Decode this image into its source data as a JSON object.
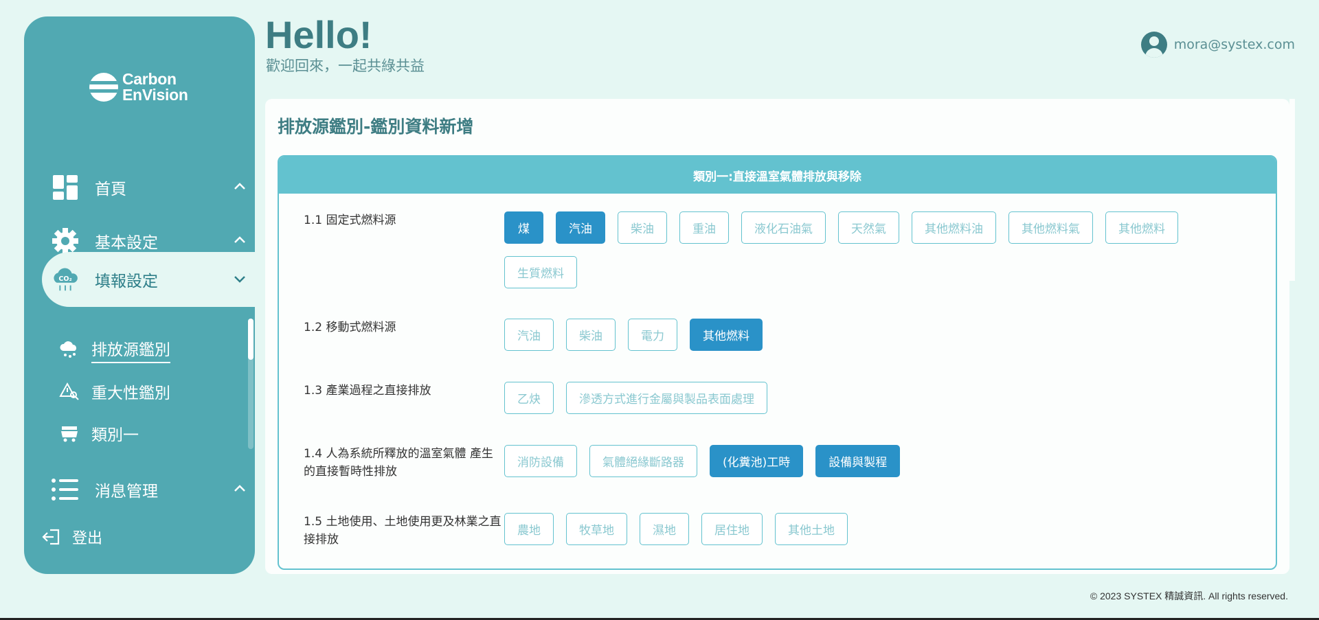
{
  "brand": {
    "line1": "Carbon",
    "line2": "EnVision"
  },
  "header": {
    "hello": "Hello!",
    "welcome": "歡迎回來，一起共綠共益",
    "user_email": "mora@systex.com"
  },
  "sidebar": {
    "items": [
      {
        "label": "首頁",
        "icon": "dashboard-icon"
      },
      {
        "label": "基本設定",
        "icon": "gear-icon"
      },
      {
        "label": "填報設定",
        "icon": "co2-cloud-icon"
      },
      {
        "label": "消息管理",
        "icon": "list-icon"
      }
    ],
    "sub_items": [
      {
        "label": "排放源鑑別",
        "icon": "cloud-rain-icon"
      },
      {
        "label": "重大性鑑別",
        "icon": "warning-search-icon"
      },
      {
        "label": "類別一",
        "icon": "factory-cart-icon"
      }
    ],
    "logout": "登出"
  },
  "main": {
    "title": "排放源鑑別-鑑別資料新增",
    "panel_title": "類別一:直接溫室氣體排放與移除",
    "rows": [
      {
        "label": "1.1 固定式燃料源",
        "chips": [
          {
            "label": "煤",
            "on": true
          },
          {
            "label": "汽油",
            "on": true
          },
          {
            "label": "柴油",
            "on": false
          },
          {
            "label": "重油",
            "on": false
          },
          {
            "label": "液化石油氣",
            "on": false
          },
          {
            "label": "天然氣",
            "on": false
          },
          {
            "label": "其他燃料油",
            "on": false
          },
          {
            "label": "其他燃料氣",
            "on": false
          },
          {
            "label": "其他燃料",
            "on": false
          },
          {
            "label": "生質燃料",
            "on": false
          }
        ]
      },
      {
        "label": "1.2 移動式燃料源",
        "chips": [
          {
            "label": "汽油",
            "on": false
          },
          {
            "label": "柴油",
            "on": false
          },
          {
            "label": "電力",
            "on": false
          },
          {
            "label": "其他燃料",
            "on": true
          }
        ]
      },
      {
        "label": "1.3 產業過程之直接排放",
        "chips": [
          {
            "label": "乙炔",
            "on": false
          },
          {
            "label": "滲透方式進行金屬與製品表面處理",
            "on": false
          }
        ]
      },
      {
        "label": "1.4 人為系統所釋放的溫室氣體 產生的直接暫時性排放",
        "chips": [
          {
            "label": "消防設備",
            "on": false
          },
          {
            "label": "氣體絕緣斷路器",
            "on": false
          },
          {
            "label": "(化糞池)工時",
            "on": true
          },
          {
            "label": "設備與製程",
            "on": true
          }
        ]
      },
      {
        "label": "1.5 土地使用、土地使用更及林業之直接排放",
        "chips": [
          {
            "label": "農地",
            "on": false
          },
          {
            "label": "牧草地",
            "on": false
          },
          {
            "label": "濕地",
            "on": false
          },
          {
            "label": "居住地",
            "on": false
          },
          {
            "label": "其他土地",
            "on": false
          }
        ]
      }
    ]
  },
  "footer": "© 2023 SYSTEX 精誠資訊. All rights reserved.",
  "colors": {
    "sidebar": "#51a9b2",
    "accent": "#63c2cf",
    "selected": "#2a92c8",
    "background": "#e5f7f3"
  }
}
